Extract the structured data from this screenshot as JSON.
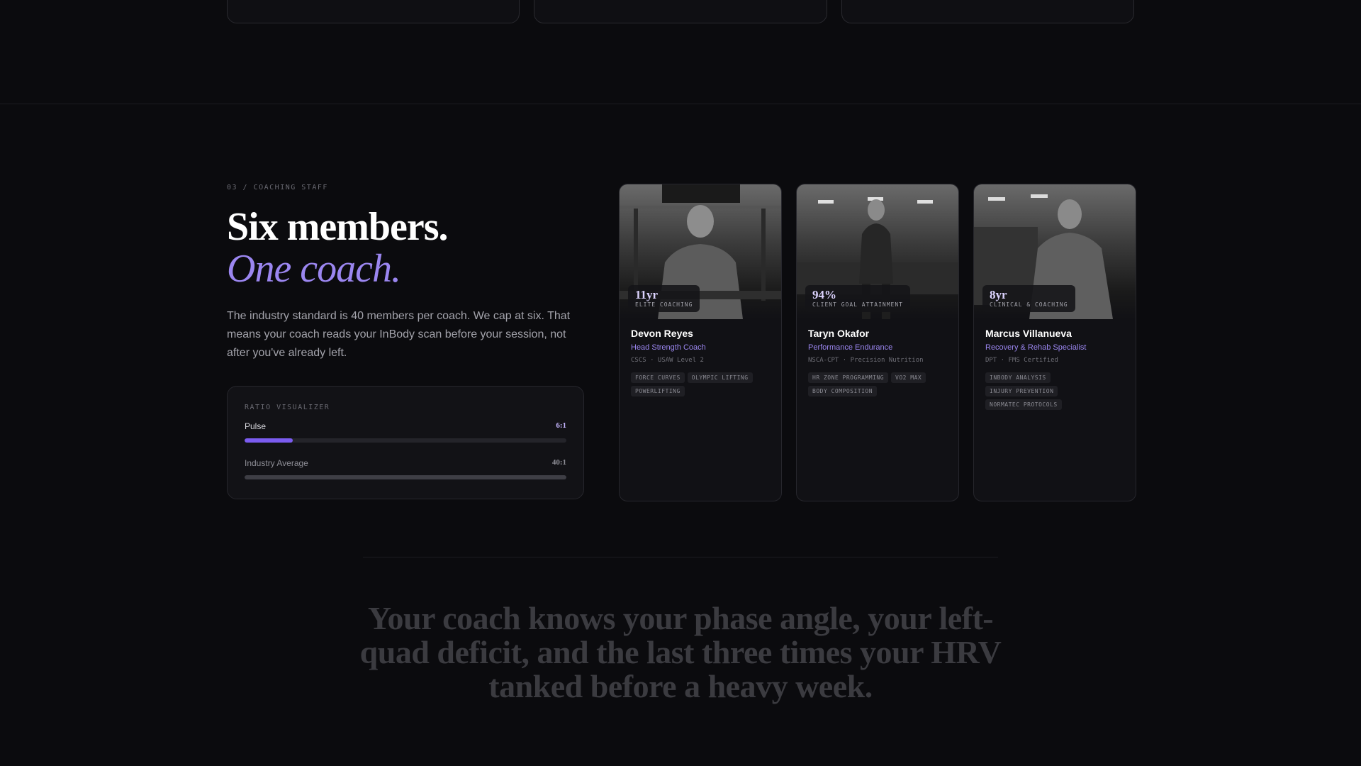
{
  "coaching": {
    "eyebrow": "03 / COACHING STAFF",
    "headline": "Six members.",
    "headline_accent": "One coach.",
    "intro": "The industry standard is 40 members per coach. We cap at six. That means your coach reads your InBody scan before your session, not after you've already left.",
    "accent_color": "#9b86f0",
    "ratio": {
      "title": "RATIO VISUALIZER",
      "rows": [
        {
          "label": "Pulse",
          "value": "6:1",
          "fill_fraction": 0.15
        },
        {
          "label": "Industry Average",
          "value": "40:1",
          "fill_fraction": 1.0
        }
      ]
    },
    "coaches": [
      {
        "photo": "coach-photo-lifting-gym",
        "stat_value": "11yr",
        "stat_label": "ELITE COACHING",
        "name": "Devon Reyes",
        "role": "Head Strength Coach",
        "creds": "CSCS · USAW Level 2",
        "tags": [
          "FORCE CURVES",
          "OLYMPIC LIFTING",
          "POWERLIFTING"
        ]
      },
      {
        "photo": "coach-photo-cardio-gym",
        "stat_value": "94%",
        "stat_label": "CLIENT GOAL ATTAINMENT",
        "name": "Taryn Okafor",
        "role": "Performance Endurance",
        "creds": "NSCA-CPT · Precision Nutrition",
        "tags": [
          "HR ZONE PROGRAMMING",
          "VO2 MAX",
          "BODY COMPOSITION"
        ]
      },
      {
        "photo": "coach-photo-clinic-gym",
        "stat_value": "8yr",
        "stat_label": "CLINICAL & COACHING",
        "name": "Marcus Villanueva",
        "role": "Recovery & Rehab Specialist",
        "creds": "DPT · FMS Certified",
        "tags": [
          "INBODY ANALYSIS",
          "INJURY PREVENTION",
          "NORMATEC PROTOCOLS"
        ]
      }
    ]
  },
  "quote": "Your coach knows your phase angle, your left-quad deficit, and the last three times your HRV tanked before a heavy week."
}
